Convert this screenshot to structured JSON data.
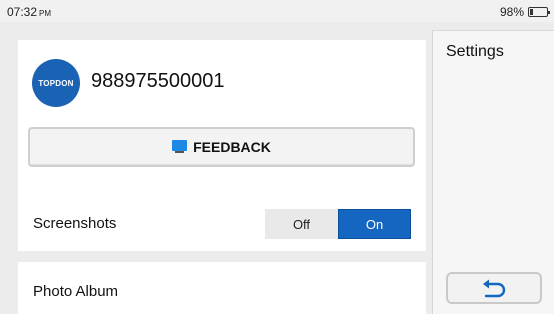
{
  "status_bar": {
    "time": "07:32",
    "ampm": "PM",
    "battery_percent": "98%"
  },
  "account": {
    "avatar_text": "TOPDON",
    "id": "988975500001"
  },
  "feedback": {
    "label": "FEEDBACK"
  },
  "screenshots": {
    "label": "Screenshots",
    "toggle_off": "Off",
    "toggle_on": "On",
    "selected": "On"
  },
  "photo_album": {
    "label": "Photo Album"
  },
  "sidebar": {
    "title": "Settings",
    "back_icon": "back-arrow-icon"
  },
  "colors": {
    "brand_blue": "#1a62b3",
    "toggle_active": "#1466c0",
    "feedback_icon": "#1e88e5"
  }
}
